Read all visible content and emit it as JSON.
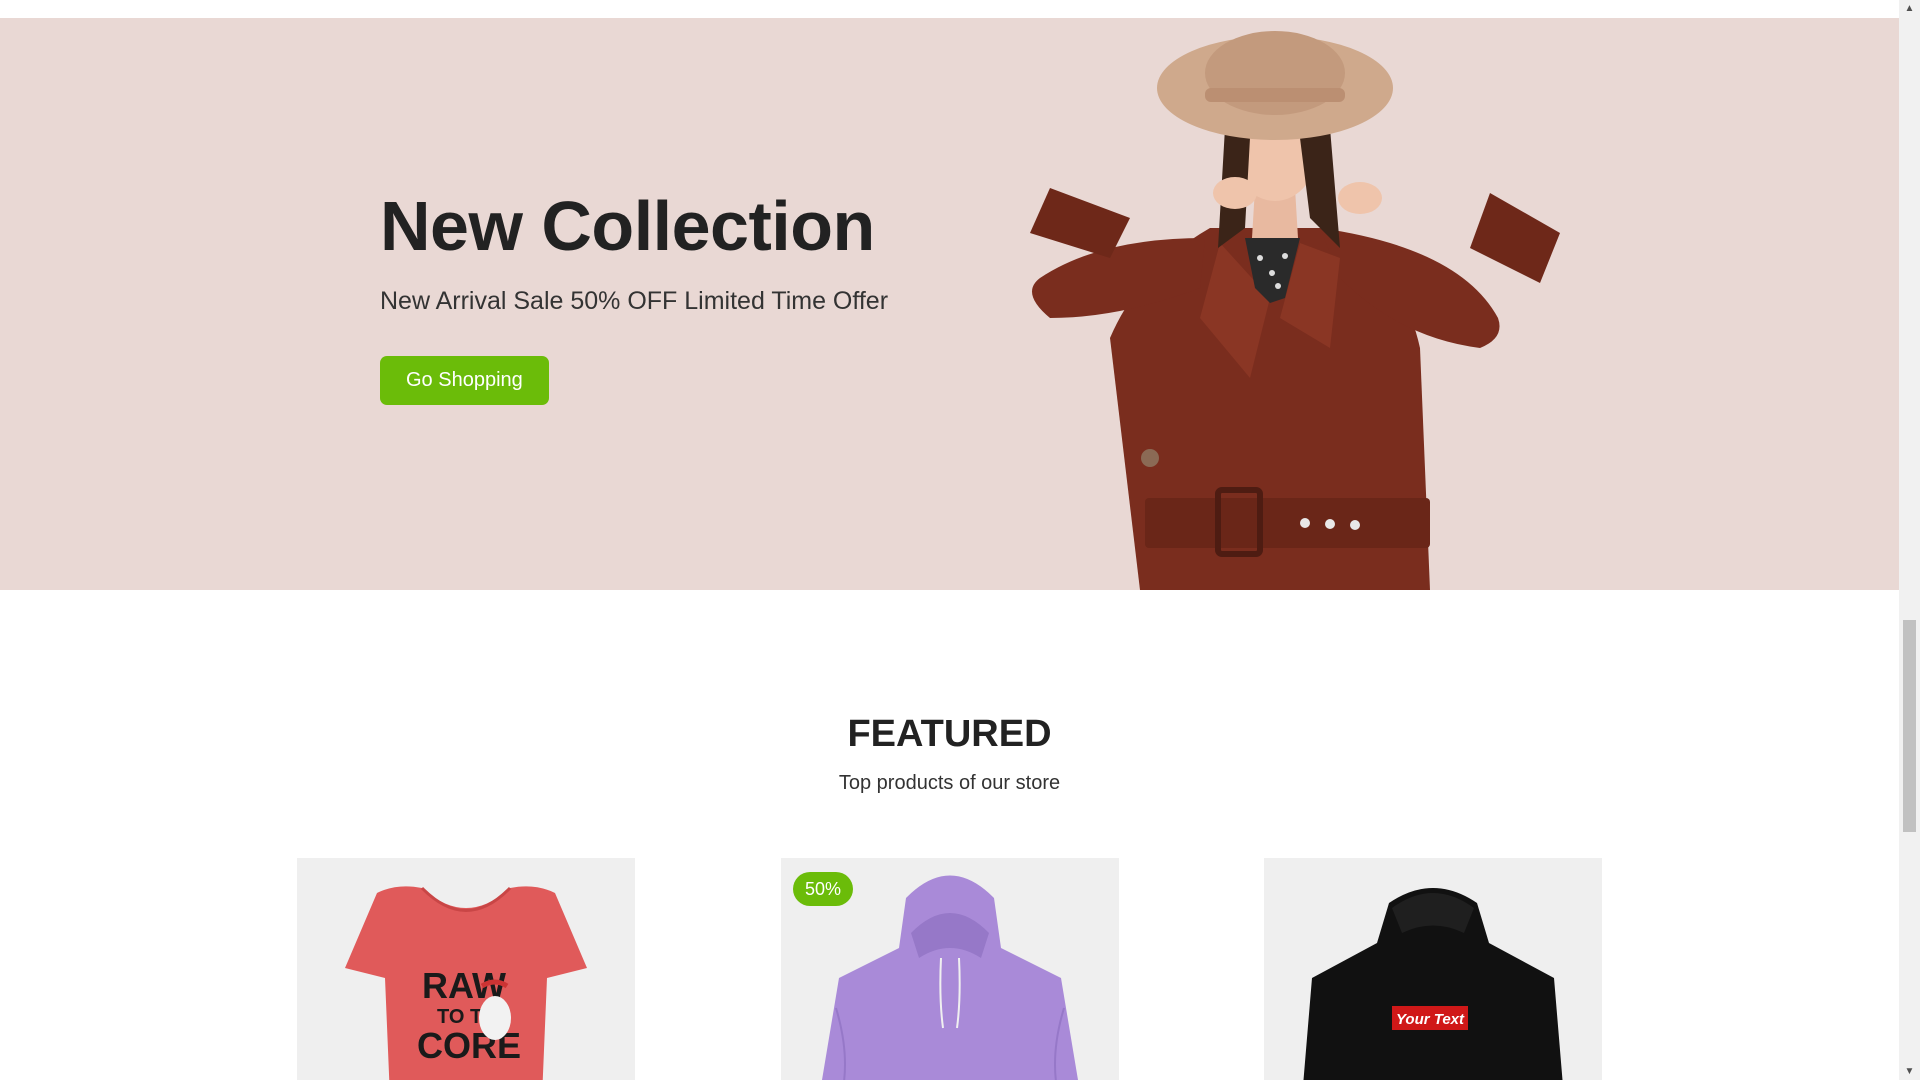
{
  "hero": {
    "title": "New Collection",
    "subtitle": "New Arrival Sale 50% OFF Limited Time Offer",
    "button_label": "Go Shopping",
    "background_color": "#e9d8d4",
    "button_color": "#6bbc09"
  },
  "featured": {
    "title": "FEATURED",
    "subtitle": "Top products of our store",
    "products": [
      {
        "image_icon": "red-tshirt-image",
        "print_text_line1": "RAW",
        "print_text_line2": "TO THE",
        "print_text_line3": "CORE"
      },
      {
        "image_icon": "purple-hoodie-image",
        "badge": "50%"
      },
      {
        "image_icon": "black-hoodie-image",
        "print_text": "Your Text"
      }
    ]
  },
  "scrollbar": {
    "up_icon": "arrow-up-icon",
    "down_icon": "arrow-down-icon"
  }
}
